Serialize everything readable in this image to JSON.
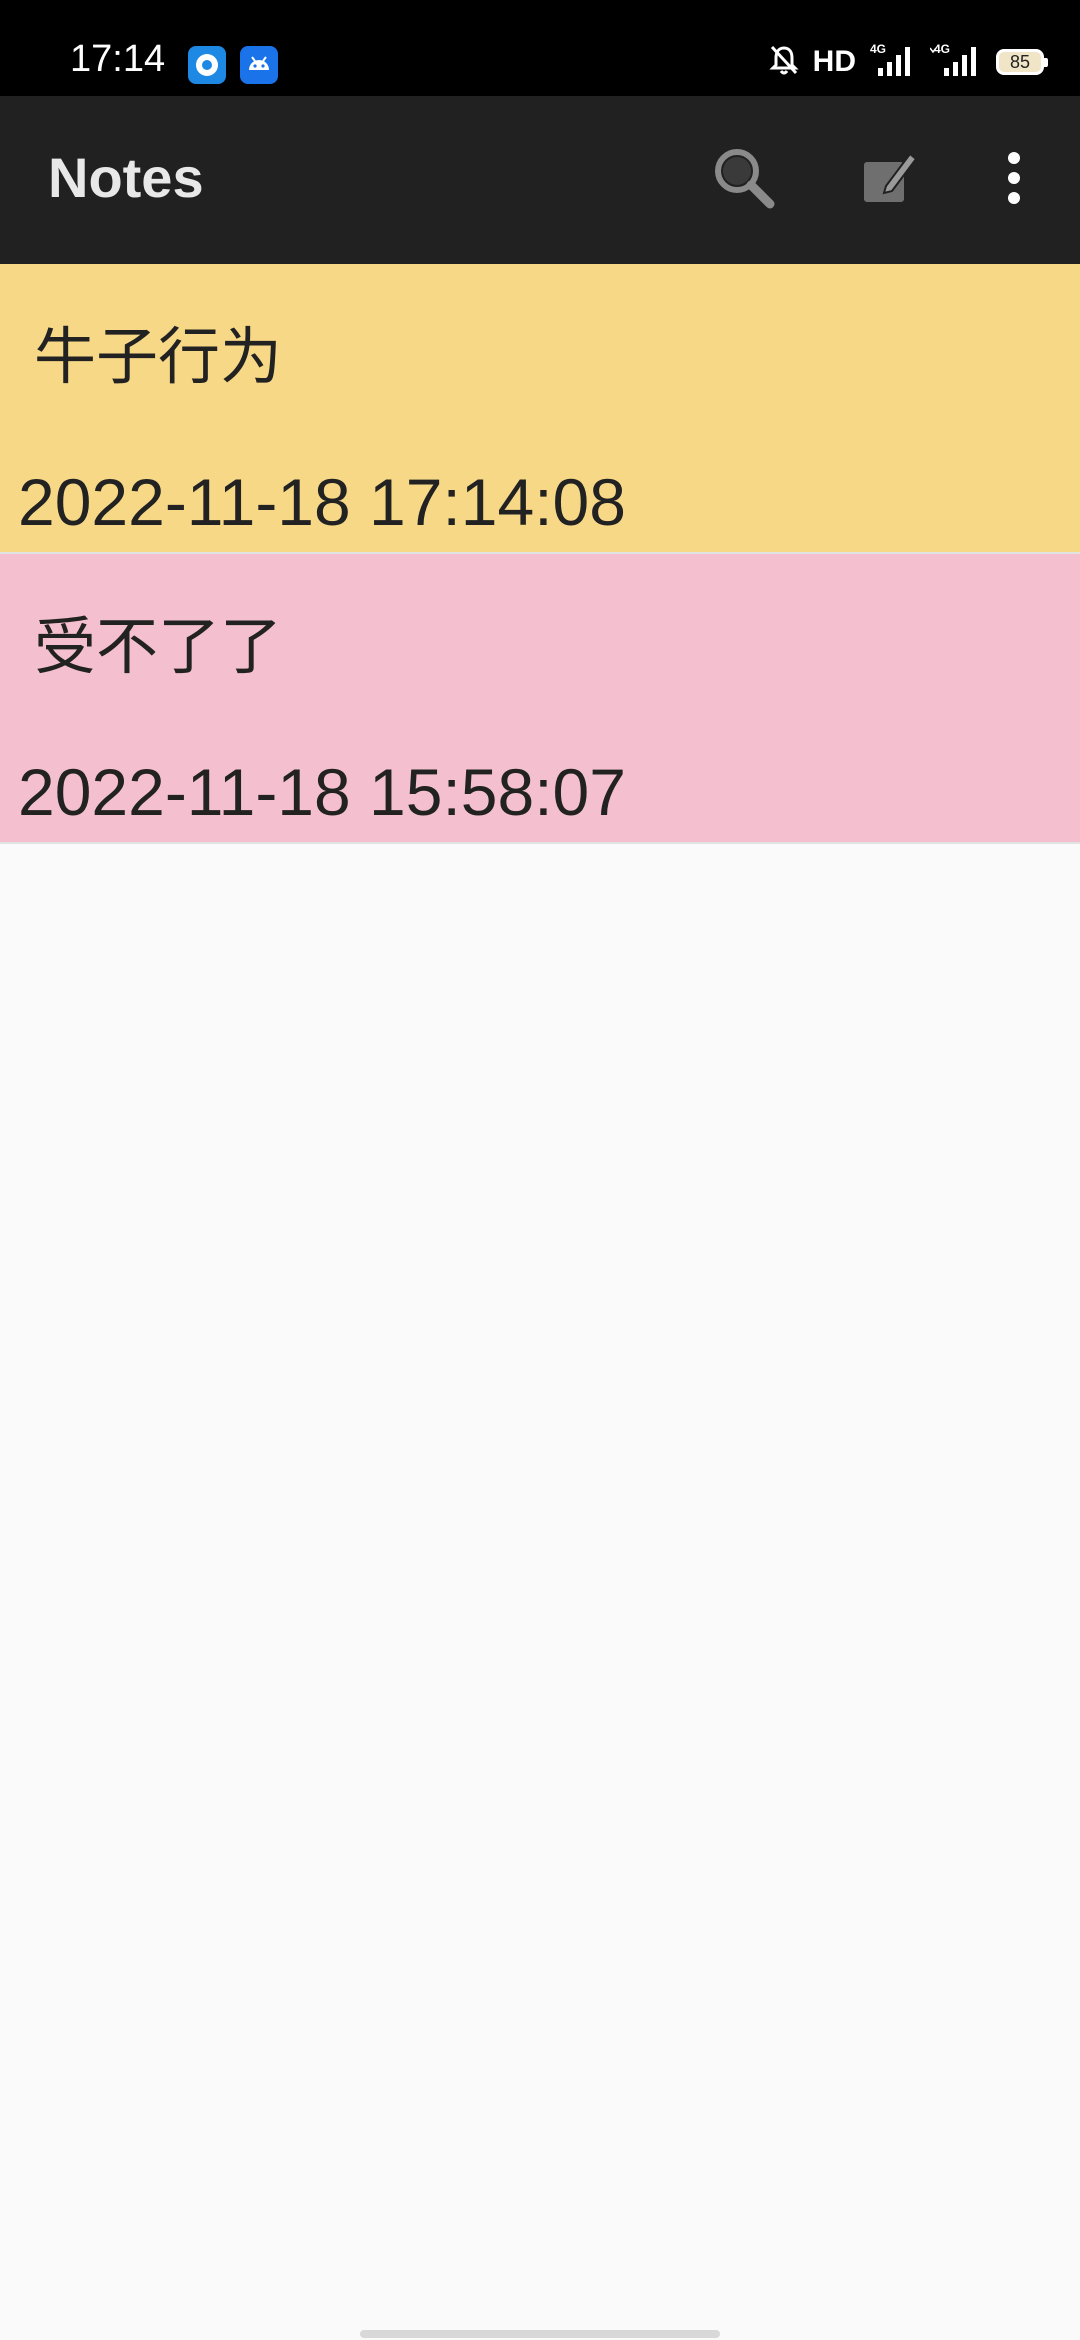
{
  "status_bar": {
    "time": "17:14",
    "hd_label": "HD",
    "battery_level": "85",
    "icons": [
      "app-notification-icon",
      "android-icon",
      "mute-bell-icon",
      "signal-4g-icon",
      "signal-4g-icon",
      "battery-icon"
    ]
  },
  "app_bar": {
    "title": "Notes",
    "actions": [
      "search-icon",
      "new-note-icon",
      "more-vert-icon"
    ],
    "background": "#212121"
  },
  "notes": [
    {
      "title": "牛子行为",
      "timestamp": "2022-11-18 17:14:08",
      "color": "#f7d886"
    },
    {
      "title": "受不了了",
      "timestamp": "2022-11-18 15:58:07",
      "color": "#f4c0cf"
    }
  ],
  "colors": {
    "page_background": "#fafafa",
    "note_yellow": "#f7d886",
    "note_pink": "#f4c0cf"
  }
}
